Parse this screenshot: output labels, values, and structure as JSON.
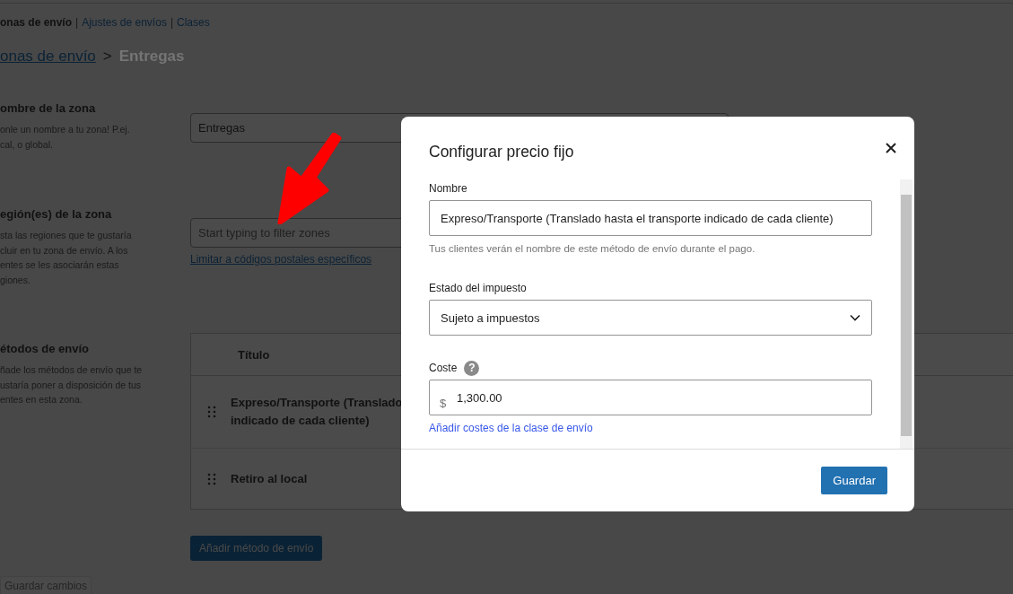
{
  "nav_tabs": [
    {
      "label": "onas de envío",
      "selected": true
    },
    {
      "label": "Ajustes de envíos",
      "selected": false
    },
    {
      "label": "Clases",
      "selected": false
    }
  ],
  "nav_separators": [
    "|",
    "|"
  ],
  "breadcrumb": {
    "link": "onas de envío",
    "separator": ">",
    "current": "Entregas"
  },
  "sections": [
    {
      "kind": "name",
      "heading": "ombre de la zona",
      "description": "onle un nombre a tu zona! P.ej.\ncal, o global.",
      "value": "Entregas"
    },
    {
      "kind": "regions",
      "heading": "egión(es) de la zona",
      "description": "sta las regiones que te gustaría\ncluir en tu zona de envío. A los\nentes se les asociarán estas\ngiones.",
      "placeholder": "Start typing to filter zones",
      "link": "Limitar a códigos postales específicos"
    },
    {
      "kind": "methods",
      "heading": "étodos de envío",
      "description": "ñade los métodos de envío que te\nustaría poner a disposición de tus\nentes en esta zona.",
      "table": {
        "columns": [
          "Título"
        ],
        "rows": [
          {
            "title": "Expreso/Transporte (Translado\nindicado de cada cliente)"
          },
          {
            "title": "Retiro al local"
          }
        ]
      },
      "button": "Añadir método de envío"
    }
  ],
  "save_button": {
    "label": "Guardar cambios",
    "disabled": true
  },
  "modal": {
    "title": "Configurar precio fijo",
    "name_label": "Nombre",
    "name_value": "Expreso/Transporte (Translado hasta el transporte indicado de cada cliente)",
    "name_help": "Tus clientes verán el nombre de este método de envío durante el pago.",
    "tax_label": "Estado del impuesto",
    "tax_value": "Sujeto a impuestos",
    "cost_label": "Coste",
    "cost_help": "?",
    "currency": "$",
    "cost_value": "1,300.00",
    "class_link": "Añadir costes de la clase de envío",
    "save": "Guardar"
  }
}
